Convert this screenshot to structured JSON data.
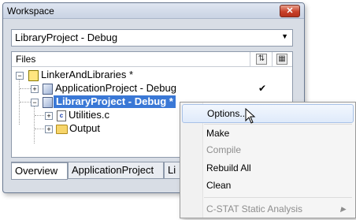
{
  "window": {
    "title": "Workspace",
    "close_glyph": "✕",
    "config_select": {
      "value": "LibraryProject - Debug",
      "arrow": "▼"
    },
    "files_header": {
      "label": "Files"
    },
    "tree": [
      {
        "label": "LinkerAndLibraries *",
        "icon": "workspace-icon",
        "expander": "−"
      },
      {
        "label": "ApplicationProject - Debug",
        "icon": "project-icon",
        "expander": "+",
        "check": "✔"
      },
      {
        "label": "LibraryProject - Debug *",
        "icon": "project-icon",
        "expander": "−",
        "selected": true
      },
      {
        "label": "Utilities.c",
        "icon": "c-file-icon",
        "expander": "+"
      },
      {
        "label": "Output",
        "icon": "folder-icon",
        "expander": "+"
      }
    ],
    "tabs": [
      "Overview",
      "ApplicationProject",
      "Li"
    ]
  },
  "context_menu": {
    "items": [
      {
        "label": "Options...",
        "state": "hover"
      },
      {
        "label": "Make",
        "state": "enabled"
      },
      {
        "label": "Compile",
        "state": "disabled"
      },
      {
        "label": "Rebuild All",
        "state": "enabled"
      },
      {
        "label": "Clean",
        "state": "enabled"
      },
      {
        "label": "C-STAT Static Analysis",
        "state": "disabled",
        "submenu": "▶"
      }
    ]
  },
  "colors": {
    "selection": "#3a78d6",
    "menu_hover": "#dfeafa",
    "window_frame": "#d8dde5"
  }
}
